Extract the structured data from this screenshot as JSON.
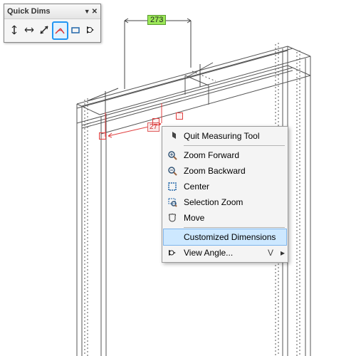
{
  "toolbar": {
    "title": "Quick Dims",
    "tools": [
      "dim-vert",
      "dim-horiz",
      "dim-aligned",
      "dim-angle",
      "dim-custom",
      "dim-view"
    ],
    "selected_index": 3,
    "close_label": "✕"
  },
  "dimensions": {
    "top_value": "273",
    "active_value": "27"
  },
  "context_menu": {
    "items": [
      {
        "icon": "quit-icon",
        "label": "Quit Measuring Tool"
      },
      {
        "sep": true
      },
      {
        "icon": "zoom-in-icon",
        "label": "Zoom Forward"
      },
      {
        "icon": "zoom-out-icon",
        "label": "Zoom Backward"
      },
      {
        "icon": "center-icon",
        "label": "Center"
      },
      {
        "icon": "sel-zoom-icon",
        "label": "Selection Zoom"
      },
      {
        "icon": "move-icon",
        "label": "Move"
      },
      {
        "sep": true
      },
      {
        "icon": "",
        "label": "Customized Dimensions",
        "highlight": true
      },
      {
        "icon": "view-angle-icon",
        "label": "View Angle...",
        "shortcut": "V"
      }
    ]
  }
}
